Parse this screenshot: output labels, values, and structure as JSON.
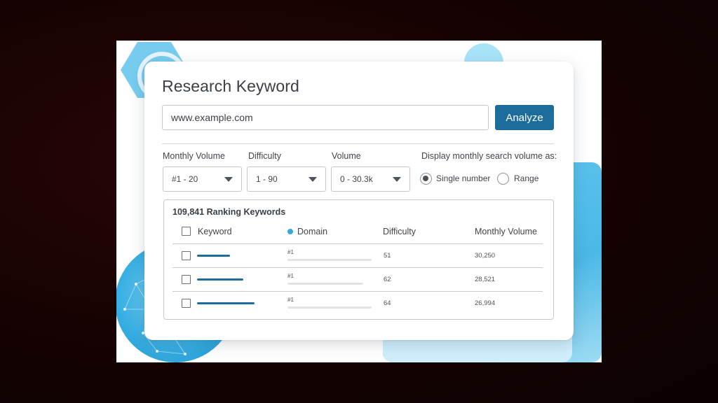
{
  "title": "Research Keyword",
  "search": {
    "value": "www.example.com",
    "button_label": "Analyze"
  },
  "filters": {
    "monthly_volume": {
      "label": "Monthly Volume",
      "value": "#1 - 20"
    },
    "difficulty": {
      "label": "Difficulty",
      "value": "1 - 90"
    },
    "volume": {
      "label": "Volume",
      "value": "0 - 30.3k"
    }
  },
  "display": {
    "label": "Display monthly search volume as:",
    "options": [
      "Single number",
      "Range"
    ],
    "selected": "Single number"
  },
  "results": {
    "count_label": "109,841 Ranking Keywords",
    "columns": [
      "Keyword",
      "Domain",
      "Difficulty",
      "Monthly Volume"
    ],
    "rows": [
      {
        "domain_rank": "#1",
        "difficulty": "51",
        "monthly_volume": "30,250"
      },
      {
        "domain_rank": "#1",
        "difficulty": "62",
        "monthly_volume": "28,521"
      },
      {
        "domain_rank": "#1",
        "difficulty": "64",
        "monthly_volume": "26,994"
      }
    ]
  },
  "colors": {
    "accent": "#1c6c9c",
    "domain_dot": "#39a9dd",
    "decor_blue": "#4bb8e6"
  }
}
